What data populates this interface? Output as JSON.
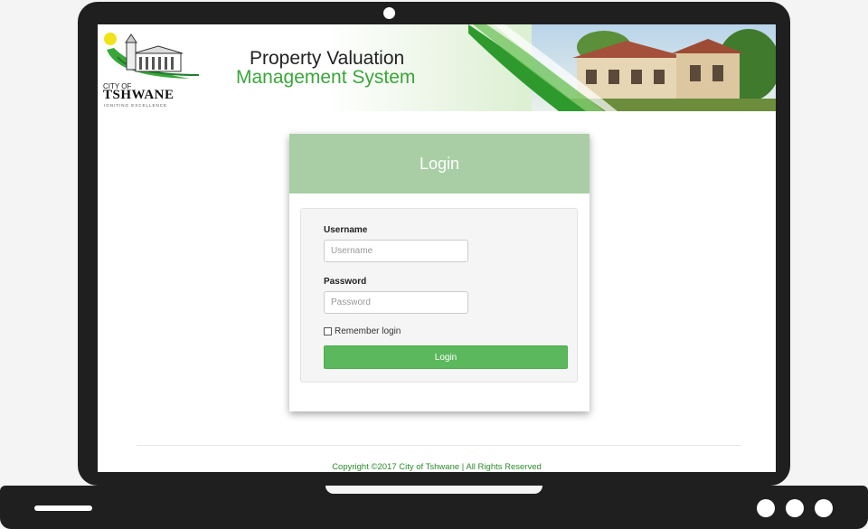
{
  "header": {
    "logo": {
      "city_line": "CITY OF",
      "name": "TSHWANE",
      "tagline": "IGNITING EXCELLENCE"
    },
    "title_line1": "Property Valuation",
    "title_line2": "Management System"
  },
  "login": {
    "title": "Login",
    "username_label": "Username",
    "username_placeholder": "Username",
    "username_value": "",
    "password_label": "Password",
    "password_placeholder": "Password",
    "password_value": "",
    "remember_label": "Remember login",
    "remember_checked": false,
    "submit_label": "Login"
  },
  "footer": {
    "copyright": "Copyright ©2017 City of Tshwane | All Rights Reserved"
  },
  "colors": {
    "brand_green": "#3aa63a",
    "card_header": "#a9cea5",
    "button": "#5cb85c",
    "frame": "#1f1f1f"
  }
}
